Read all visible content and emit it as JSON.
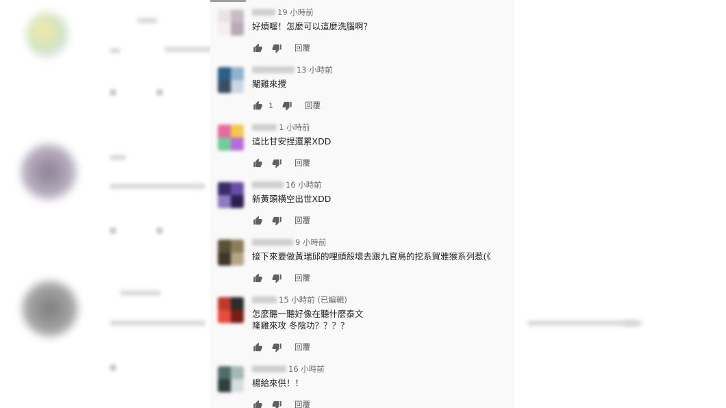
{
  "comments": [
    {
      "time": "19 小時前",
      "lines": [
        "好煩喔！怎麼可以這麼洗腦啊？"
      ],
      "likes": "",
      "reply": "回覆"
    },
    {
      "time": "13 小時前",
      "lines": [
        "閹雞來攪"
      ],
      "likes": "1",
      "reply": "回覆"
    },
    {
      "time": "1 小時前",
      "lines": [
        "這比甘安捏還累XDD"
      ],
      "likes": "",
      "reply": "回覆"
    },
    {
      "time": "16 小時前",
      "lines": [
        "新黃頭横空出世XDD"
      ],
      "likes": "",
      "reply": "回覆"
    },
    {
      "time": "9 小時前",
      "lines": [
        "接下來要做黃瑞邱的哩頭殼壞去跟九官鳥的挖系賀雅猴系列惹(《"
      ],
      "likes": "",
      "reply": "回覆"
    },
    {
      "time": "15 小時前 (已編輯)",
      "lines": [
        "怎麼聽一聽好像在聽什麼泰文",
        "隆雞來攻 冬陰功？？？？"
      ],
      "likes": "",
      "reply": "回覆"
    },
    {
      "time": "16 小時前",
      "lines": [
        "楊給來供！！"
      ],
      "likes": "",
      "reply": "回覆"
    }
  ],
  "icons": {
    "like": "thumbs-up-icon",
    "dislike": "thumbs-down-icon"
  },
  "colors": {
    "panel": "#f9f9f9",
    "text": "#1f1f1f",
    "meta": "#6c6c6c",
    "icon": "#606060"
  }
}
